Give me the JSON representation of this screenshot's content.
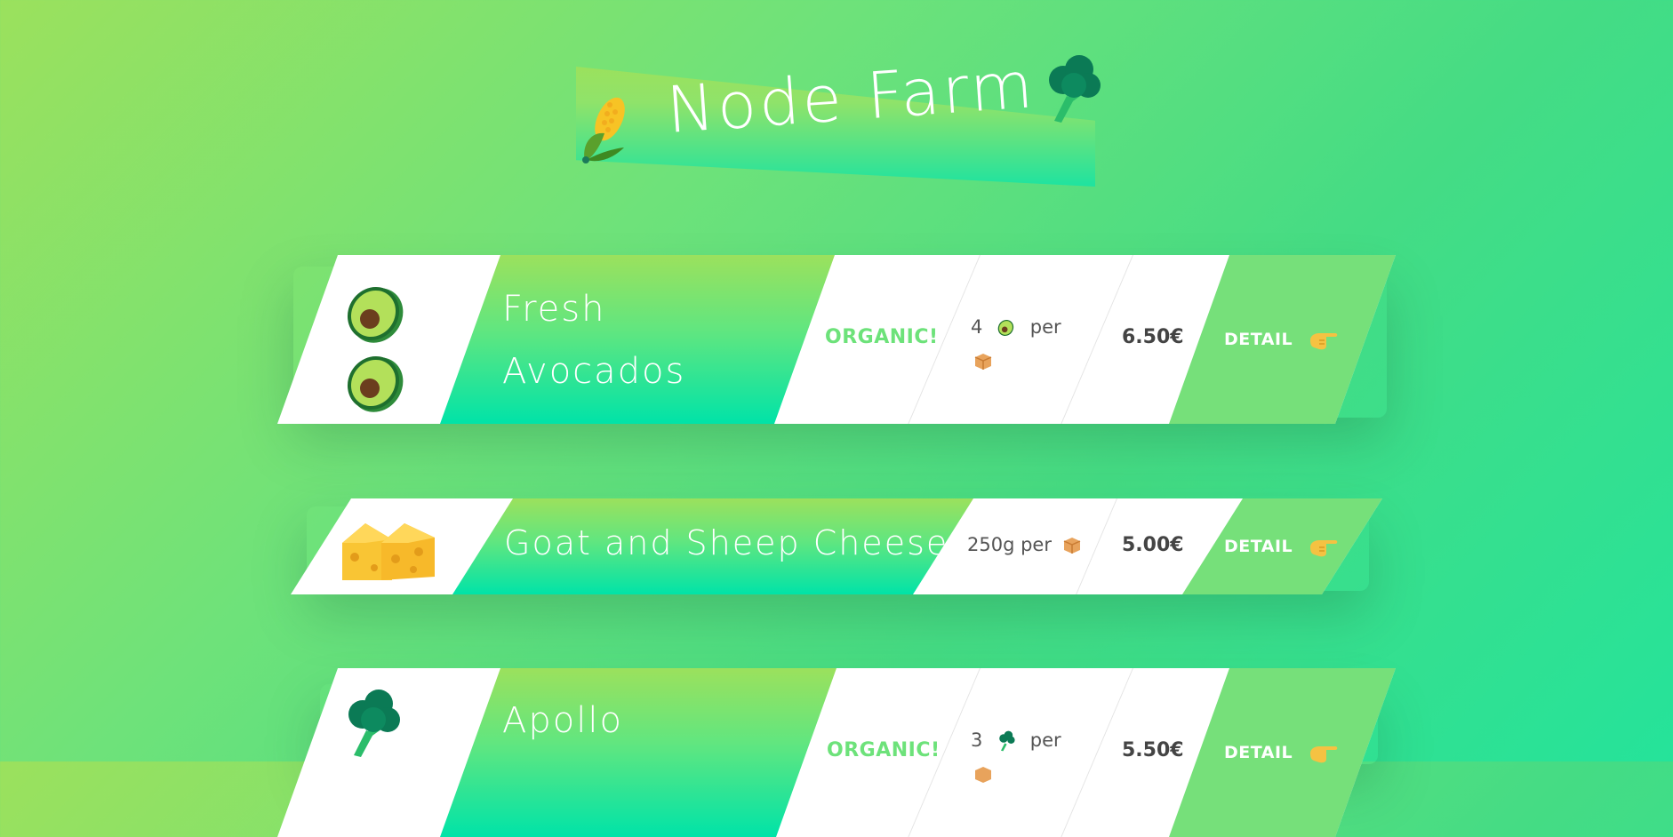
{
  "header": {
    "title": "Node Farm",
    "left_icon": "corn-icon",
    "right_icon": "broccoli-icon"
  },
  "colors": {
    "accent_green": "#76e07a",
    "gradient_top": "#9be15d",
    "gradient_bottom": "#00e3a8",
    "text_dark": "#444444"
  },
  "products": [
    {
      "icon": "avocado-icon",
      "name_line1": "Fresh",
      "name_line2": "Avocados",
      "organic_label": "ORGANIC!",
      "quantity_number": "4",
      "quantity_icon": "avocado-icon",
      "quantity_per": "per",
      "quantity_unit_icon": "package-icon",
      "price": "6.50€",
      "detail_label": "DETAIL",
      "detail_icon": "pointing-hand-icon"
    },
    {
      "icon": "cheese-icon",
      "name": "Goat and Sheep Cheese",
      "quantity_text": "250g per",
      "quantity_unit_icon": "package-icon",
      "price": "5.00€",
      "detail_label": "DETAIL",
      "detail_icon": "pointing-hand-icon"
    },
    {
      "icon": "broccoli-icon",
      "name_line1": "Apollo",
      "organic_label": "ORGANIC!",
      "quantity_number": "3",
      "quantity_icon": "broccoli-icon",
      "quantity_per": "per",
      "quantity_unit_icon": "package-icon",
      "price": "5.50€",
      "detail_label": "DETAIL",
      "detail_icon": "pointing-hand-icon"
    }
  ]
}
